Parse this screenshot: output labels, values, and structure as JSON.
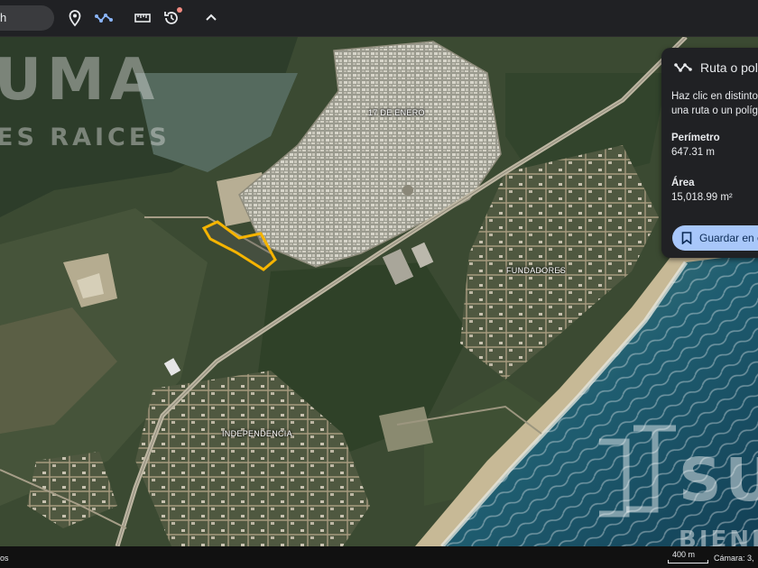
{
  "toolbar": {
    "search_text": "h",
    "icons": [
      "location-pin-icon",
      "route-icon",
      "ruler-icon",
      "history-icon",
      "chevron-up-icon"
    ]
  },
  "watermark": {
    "top_text": "UMA",
    "sub_text": "ES RAICES",
    "logo_text": "SU",
    "logo_sub": "BIENE"
  },
  "map_labels": {
    "area1": "17 DE ENERO",
    "area2": "FUNDADORES",
    "area3": "INDEPENDENCIA"
  },
  "panel": {
    "title": "Ruta o polí",
    "help_line1": "Haz clic en distintos",
    "help_line2": "una ruta o un polígo",
    "perimeter_label": "Perímetro",
    "perimeter_value": "647.31 m",
    "area_label": "Área",
    "area_value": "15,018.99 m²",
    "save_label": "Guardar en e"
  },
  "status": {
    "left_text": "os",
    "scale_text": "400 m",
    "camera_text": "Cámara: 3,"
  },
  "colors": {
    "polygon_outline": "#f5b400",
    "save_button": "#a8c7fa",
    "panel_bg": "#202124"
  }
}
